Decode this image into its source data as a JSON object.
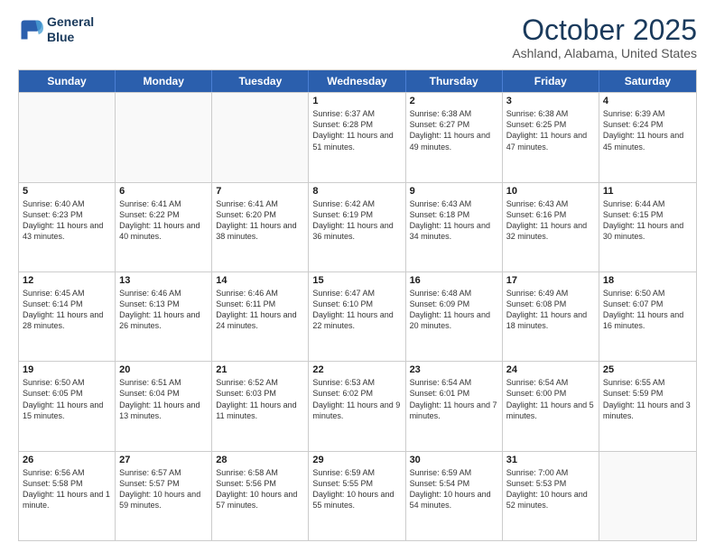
{
  "header": {
    "logo_line1": "General",
    "logo_line2": "Blue",
    "month_title": "October 2025",
    "location": "Ashland, Alabama, United States"
  },
  "day_headers": [
    "Sunday",
    "Monday",
    "Tuesday",
    "Wednesday",
    "Thursday",
    "Friday",
    "Saturday"
  ],
  "rows": [
    [
      {
        "day": "",
        "sunrise": "",
        "sunset": "",
        "daylight": "",
        "empty": true
      },
      {
        "day": "",
        "sunrise": "",
        "sunset": "",
        "daylight": "",
        "empty": true
      },
      {
        "day": "",
        "sunrise": "",
        "sunset": "",
        "daylight": "",
        "empty": true
      },
      {
        "day": "1",
        "sunrise": "Sunrise: 6:37 AM",
        "sunset": "Sunset: 6:28 PM",
        "daylight": "Daylight: 11 hours and 51 minutes."
      },
      {
        "day": "2",
        "sunrise": "Sunrise: 6:38 AM",
        "sunset": "Sunset: 6:27 PM",
        "daylight": "Daylight: 11 hours and 49 minutes."
      },
      {
        "day": "3",
        "sunrise": "Sunrise: 6:38 AM",
        "sunset": "Sunset: 6:25 PM",
        "daylight": "Daylight: 11 hours and 47 minutes."
      },
      {
        "day": "4",
        "sunrise": "Sunrise: 6:39 AM",
        "sunset": "Sunset: 6:24 PM",
        "daylight": "Daylight: 11 hours and 45 minutes."
      }
    ],
    [
      {
        "day": "5",
        "sunrise": "Sunrise: 6:40 AM",
        "sunset": "Sunset: 6:23 PM",
        "daylight": "Daylight: 11 hours and 43 minutes."
      },
      {
        "day": "6",
        "sunrise": "Sunrise: 6:41 AM",
        "sunset": "Sunset: 6:22 PM",
        "daylight": "Daylight: 11 hours and 40 minutes."
      },
      {
        "day": "7",
        "sunrise": "Sunrise: 6:41 AM",
        "sunset": "Sunset: 6:20 PM",
        "daylight": "Daylight: 11 hours and 38 minutes."
      },
      {
        "day": "8",
        "sunrise": "Sunrise: 6:42 AM",
        "sunset": "Sunset: 6:19 PM",
        "daylight": "Daylight: 11 hours and 36 minutes."
      },
      {
        "day": "9",
        "sunrise": "Sunrise: 6:43 AM",
        "sunset": "Sunset: 6:18 PM",
        "daylight": "Daylight: 11 hours and 34 minutes."
      },
      {
        "day": "10",
        "sunrise": "Sunrise: 6:43 AM",
        "sunset": "Sunset: 6:16 PM",
        "daylight": "Daylight: 11 hours and 32 minutes."
      },
      {
        "day": "11",
        "sunrise": "Sunrise: 6:44 AM",
        "sunset": "Sunset: 6:15 PM",
        "daylight": "Daylight: 11 hours and 30 minutes."
      }
    ],
    [
      {
        "day": "12",
        "sunrise": "Sunrise: 6:45 AM",
        "sunset": "Sunset: 6:14 PM",
        "daylight": "Daylight: 11 hours and 28 minutes."
      },
      {
        "day": "13",
        "sunrise": "Sunrise: 6:46 AM",
        "sunset": "Sunset: 6:13 PM",
        "daylight": "Daylight: 11 hours and 26 minutes."
      },
      {
        "day": "14",
        "sunrise": "Sunrise: 6:46 AM",
        "sunset": "Sunset: 6:11 PM",
        "daylight": "Daylight: 11 hours and 24 minutes."
      },
      {
        "day": "15",
        "sunrise": "Sunrise: 6:47 AM",
        "sunset": "Sunset: 6:10 PM",
        "daylight": "Daylight: 11 hours and 22 minutes."
      },
      {
        "day": "16",
        "sunrise": "Sunrise: 6:48 AM",
        "sunset": "Sunset: 6:09 PM",
        "daylight": "Daylight: 11 hours and 20 minutes."
      },
      {
        "day": "17",
        "sunrise": "Sunrise: 6:49 AM",
        "sunset": "Sunset: 6:08 PM",
        "daylight": "Daylight: 11 hours and 18 minutes."
      },
      {
        "day": "18",
        "sunrise": "Sunrise: 6:50 AM",
        "sunset": "Sunset: 6:07 PM",
        "daylight": "Daylight: 11 hours and 16 minutes."
      }
    ],
    [
      {
        "day": "19",
        "sunrise": "Sunrise: 6:50 AM",
        "sunset": "Sunset: 6:05 PM",
        "daylight": "Daylight: 11 hours and 15 minutes."
      },
      {
        "day": "20",
        "sunrise": "Sunrise: 6:51 AM",
        "sunset": "Sunset: 6:04 PM",
        "daylight": "Daylight: 11 hours and 13 minutes."
      },
      {
        "day": "21",
        "sunrise": "Sunrise: 6:52 AM",
        "sunset": "Sunset: 6:03 PM",
        "daylight": "Daylight: 11 hours and 11 minutes."
      },
      {
        "day": "22",
        "sunrise": "Sunrise: 6:53 AM",
        "sunset": "Sunset: 6:02 PM",
        "daylight": "Daylight: 11 hours and 9 minutes."
      },
      {
        "day": "23",
        "sunrise": "Sunrise: 6:54 AM",
        "sunset": "Sunset: 6:01 PM",
        "daylight": "Daylight: 11 hours and 7 minutes."
      },
      {
        "day": "24",
        "sunrise": "Sunrise: 6:54 AM",
        "sunset": "Sunset: 6:00 PM",
        "daylight": "Daylight: 11 hours and 5 minutes."
      },
      {
        "day": "25",
        "sunrise": "Sunrise: 6:55 AM",
        "sunset": "Sunset: 5:59 PM",
        "daylight": "Daylight: 11 hours and 3 minutes."
      }
    ],
    [
      {
        "day": "26",
        "sunrise": "Sunrise: 6:56 AM",
        "sunset": "Sunset: 5:58 PM",
        "daylight": "Daylight: 11 hours and 1 minute."
      },
      {
        "day": "27",
        "sunrise": "Sunrise: 6:57 AM",
        "sunset": "Sunset: 5:57 PM",
        "daylight": "Daylight: 10 hours and 59 minutes."
      },
      {
        "day": "28",
        "sunrise": "Sunrise: 6:58 AM",
        "sunset": "Sunset: 5:56 PM",
        "daylight": "Daylight: 10 hours and 57 minutes."
      },
      {
        "day": "29",
        "sunrise": "Sunrise: 6:59 AM",
        "sunset": "Sunset: 5:55 PM",
        "daylight": "Daylight: 10 hours and 55 minutes."
      },
      {
        "day": "30",
        "sunrise": "Sunrise: 6:59 AM",
        "sunset": "Sunset: 5:54 PM",
        "daylight": "Daylight: 10 hours and 54 minutes."
      },
      {
        "day": "31",
        "sunrise": "Sunrise: 7:00 AM",
        "sunset": "Sunset: 5:53 PM",
        "daylight": "Daylight: 10 hours and 52 minutes."
      },
      {
        "day": "",
        "sunrise": "",
        "sunset": "",
        "daylight": "",
        "empty": true
      }
    ]
  ]
}
